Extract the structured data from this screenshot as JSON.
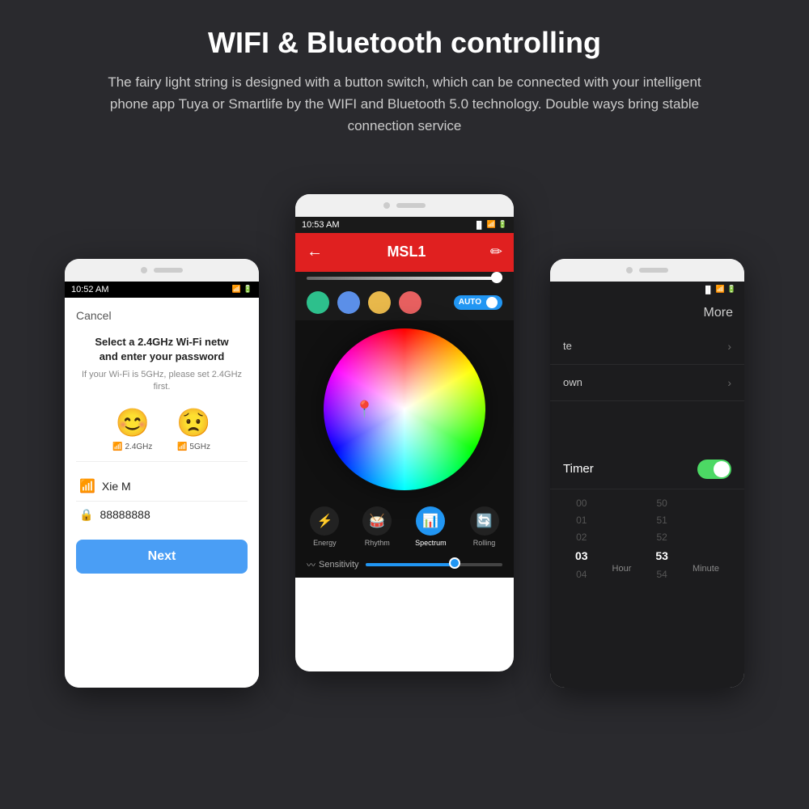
{
  "header": {
    "title": "WIFI & Bluetooth controlling",
    "description": "The fairy light string is designed with a button switch, which can be connected with your intelligent phone app Tuya or Smartlife by the WIFI and Bluetooth 5.0 technology. Double ways bring stable connection service"
  },
  "phone_left": {
    "time": "10:52 AM",
    "cancel_label": "Cancel",
    "instruction_line1": "Select a 2.4GHz Wi-Fi netw",
    "instruction_line2": "and enter your password",
    "sub_note": "If your Wi-Fi is 5GHz, please set 2.4GHz first.",
    "freq_24": "2.4GHz",
    "freq_5": "5GHz",
    "wifi_name": "Xie M",
    "password": "88888888",
    "next_label": "Next"
  },
  "phone_center": {
    "time": "10:53 AM",
    "title": "MSL1",
    "auto_label": "AUTO",
    "modes": [
      {
        "icon": "⚡",
        "label": "Energy",
        "active": false
      },
      {
        "icon": "🥁",
        "label": "Rhythm",
        "active": false
      },
      {
        "icon": "📊",
        "label": "Spectrum",
        "active": true
      },
      {
        "icon": "🔄",
        "label": "Rolling",
        "active": false
      }
    ],
    "sensitivity_label": "Sensitivity"
  },
  "phone_right": {
    "more_label": "More",
    "item1_label": "te",
    "item2_label": "own",
    "timer_label": "Timer",
    "time_cols": {
      "hours": [
        "00",
        "01",
        "02",
        "03",
        "04"
      ],
      "hour_selected": "03",
      "minutes": [
        "50",
        "51",
        "52",
        "53",
        "54"
      ],
      "minute_selected": "53"
    },
    "hour_label": "Hour",
    "minute_label": "Minute"
  }
}
